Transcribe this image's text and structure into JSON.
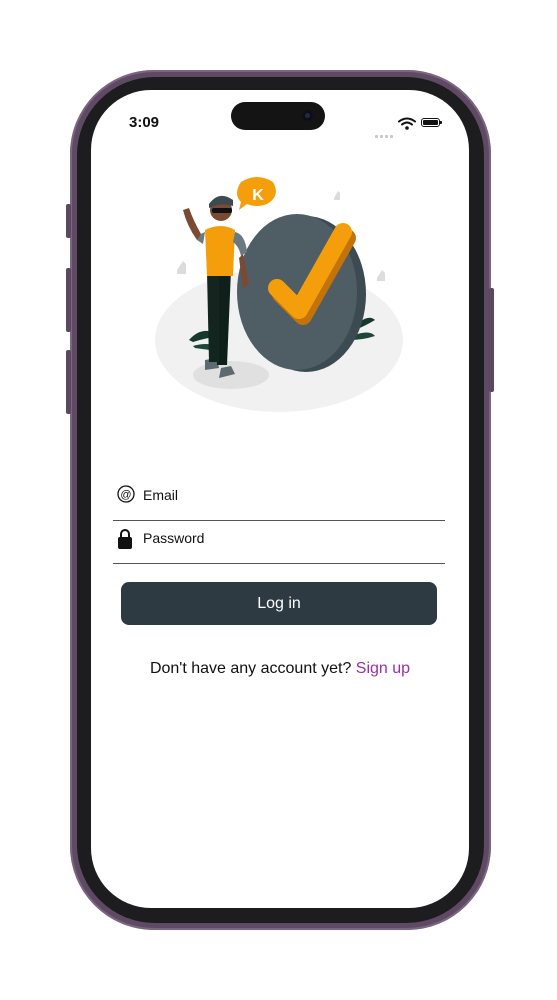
{
  "status_bar": {
    "time": "3:09"
  },
  "icons": {
    "wifi": "wifi-icon",
    "battery": "battery-icon",
    "email": "at-sign-icon",
    "password": "lock-icon",
    "badge_letter": "K"
  },
  "colors": {
    "accent_orange": "#f59e0b",
    "button_bg": "#2d3a41",
    "link": "#9b2fa5",
    "frame": "#5e4a63"
  },
  "login_form": {
    "email_placeholder": "Email",
    "password_placeholder": "Password",
    "login_button": "Log in"
  },
  "signup": {
    "prompt": "Don't have any account yet?",
    "link": "Sign up"
  }
}
